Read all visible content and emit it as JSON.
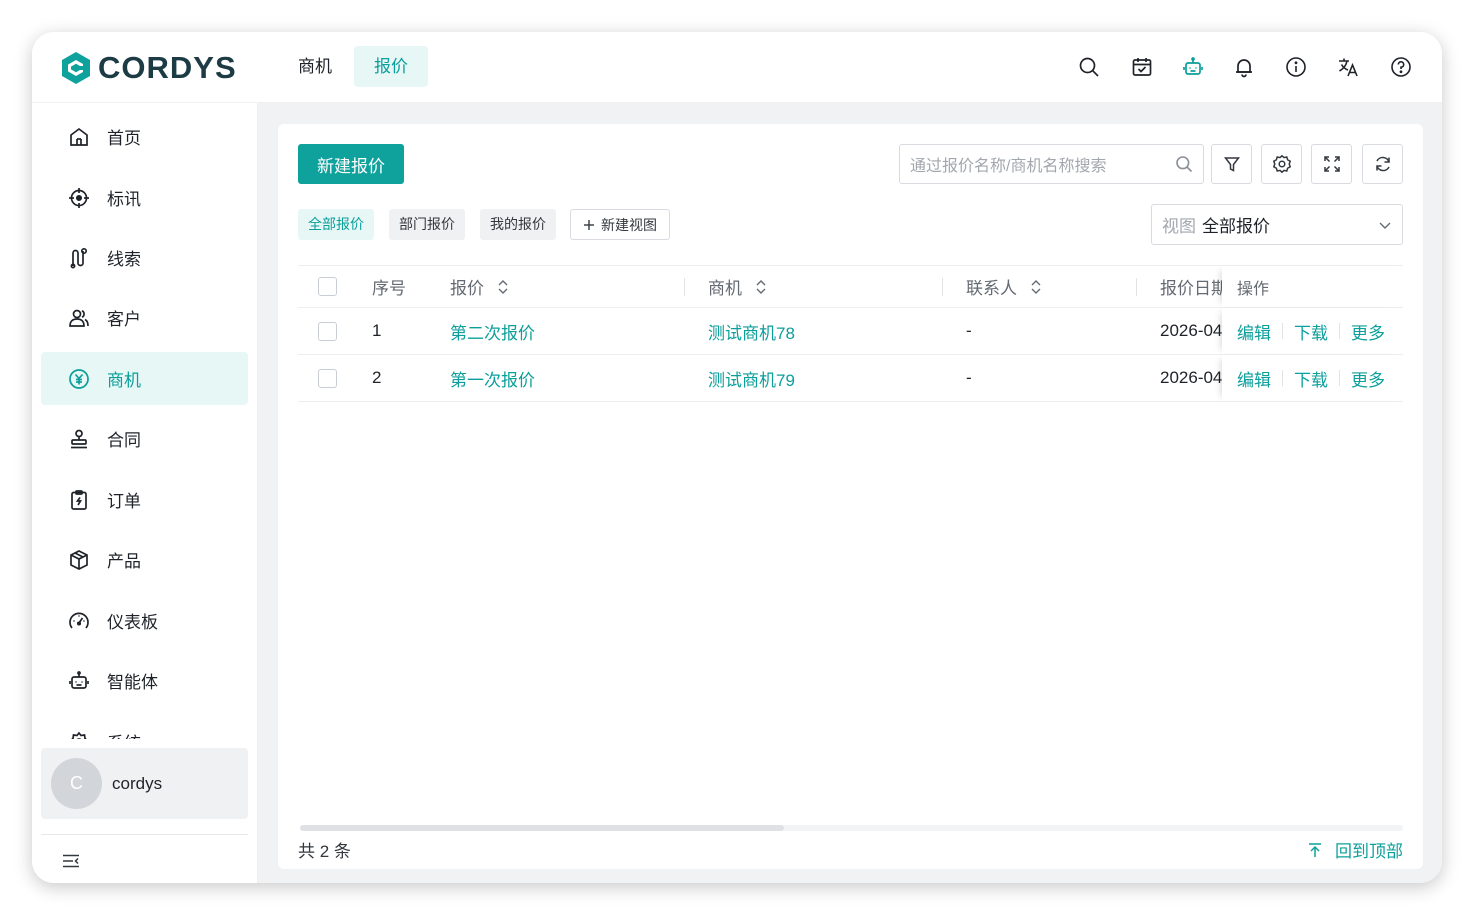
{
  "brand": {
    "name": "CORDYS",
    "color": "#0fa29d"
  },
  "top_tabs": [
    {
      "label": "商机",
      "active": false
    },
    {
      "label": "报价",
      "active": true
    }
  ],
  "header_icons": [
    "search-icon",
    "calendar-check-icon",
    "robot-icon",
    "bell-icon",
    "info-icon",
    "translate-icon",
    "help-icon"
  ],
  "sidebar": {
    "items": [
      {
        "label": "首页",
        "icon": "home-icon",
        "active": false
      },
      {
        "label": "标讯",
        "icon": "target-icon",
        "active": false
      },
      {
        "label": "线索",
        "icon": "clue-icon",
        "active": false
      },
      {
        "label": "客户",
        "icon": "customer-icon",
        "active": false
      },
      {
        "label": "商机",
        "icon": "yen-icon",
        "active": true
      },
      {
        "label": "合同",
        "icon": "stamp-icon",
        "active": false
      },
      {
        "label": "订单",
        "icon": "clipboard-icon",
        "active": false
      },
      {
        "label": "产品",
        "icon": "box-icon",
        "active": false
      },
      {
        "label": "仪表板",
        "icon": "dashboard-icon",
        "active": false
      },
      {
        "label": "智能体",
        "icon": "robot-icon",
        "active": false
      },
      {
        "label": "系统",
        "icon": "system-icon",
        "active": false
      }
    ],
    "user": {
      "initial": "C",
      "name": "cordys"
    }
  },
  "toolbar": {
    "new_button": "新建报价",
    "search_placeholder": "通过报价名称/商机名称搜索"
  },
  "view_tabs": [
    {
      "label": "全部报价",
      "active": true
    },
    {
      "label": "部门报价",
      "active": false
    },
    {
      "label": "我的报价",
      "active": false
    }
  ],
  "new_view_label": "新建视图",
  "view_select": {
    "prefix": "视图",
    "value": "全部报价"
  },
  "table": {
    "columns": {
      "index": "序号",
      "quote": "报价",
      "opportunity": "商机",
      "contact": "联系人",
      "date": "报价日期",
      "actions": "操作"
    },
    "rows": [
      {
        "index": "1",
        "quote": "第二次报价",
        "opportunity": "测试商机78",
        "contact": "-",
        "date": "2026-04"
      },
      {
        "index": "2",
        "quote": "第一次报价",
        "opportunity": "测试商机79",
        "contact": "-",
        "date": "2026-04"
      }
    ],
    "actions": {
      "edit": "编辑",
      "download": "下载",
      "more": "更多"
    }
  },
  "footer": {
    "total": "共 2 条",
    "back_to_top": "回到顶部"
  },
  "colors": {
    "accent": "#0fa29d",
    "active_bg": "#e6f7f6",
    "main_bg": "#f0f2f4"
  }
}
